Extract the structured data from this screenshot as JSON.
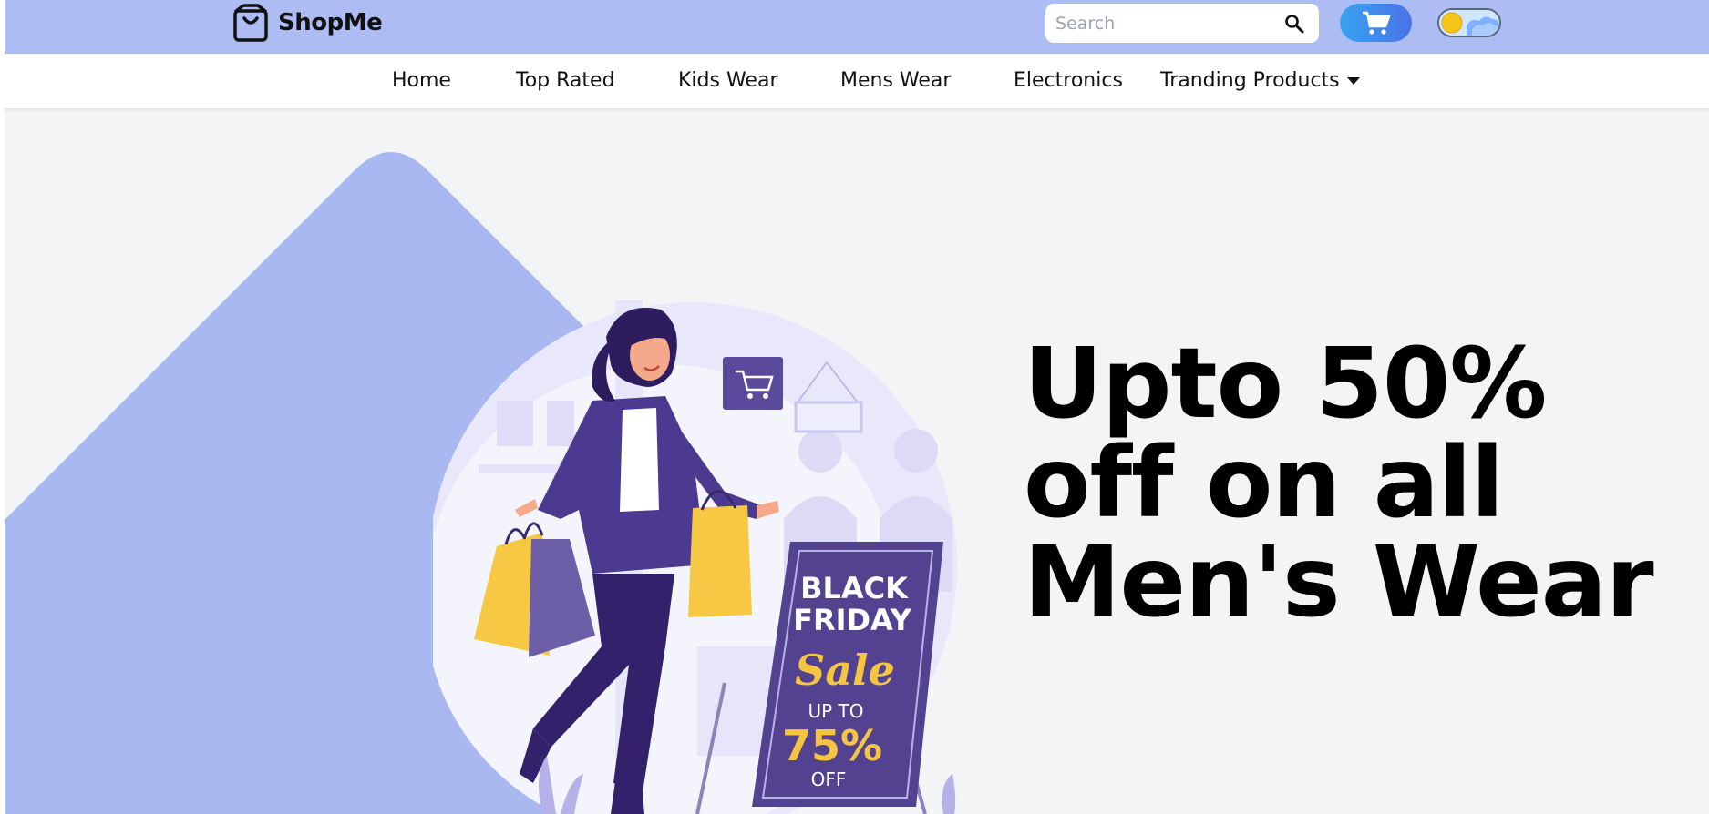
{
  "brand": {
    "name": "ShopMe",
    "logo_icon": "shopping-bag-icon"
  },
  "search": {
    "placeholder": "Search",
    "value": "",
    "icon": "search-icon"
  },
  "cart": {
    "icon": "cart-icon"
  },
  "theme_toggle": {
    "state": "light",
    "icon": "sun-icon"
  },
  "nav": {
    "items": [
      {
        "label": "Home"
      },
      {
        "label": "Top Rated"
      },
      {
        "label": "Kids Wear"
      },
      {
        "label": "Mens Wear"
      },
      {
        "label": "Electronics"
      },
      {
        "label": "Tranding Products",
        "icon": "caret-down-icon"
      }
    ]
  },
  "hero": {
    "headline": "Upto 50% off on all Men's Wear",
    "sign": {
      "line1": "BLACK",
      "line2": "FRIDAY",
      "line3": "Sale",
      "line4": "UP TO",
      "line5": "75%",
      "line6": "OFF"
    }
  },
  "colors": {
    "topbar": "#aebcf4",
    "nav_bg": "#ffffff",
    "page_bg": "#f3f4f6",
    "hero_shape": "#a9b8f0",
    "cart_gradient_start": "#38a3ef",
    "cart_gradient_end": "#4a72e8",
    "sign_bg": "#4f3f8f",
    "bag_yellow": "#f5c542"
  }
}
